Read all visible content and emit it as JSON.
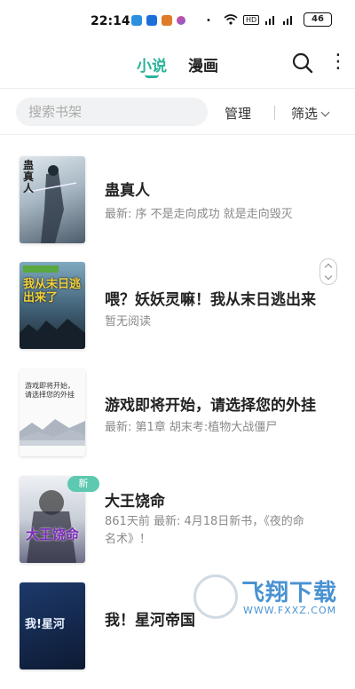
{
  "status_bar": {
    "time": "22:14",
    "signal_badge": "HD",
    "battery": "46",
    "bullet": "•"
  },
  "nav": {
    "tab_novel": "小说",
    "tab_comic": "漫画",
    "search_icon": "search-icon",
    "more_icon": "more-vertical-icon",
    "more_glyph": "⋮"
  },
  "toolbar": {
    "search_placeholder": "搜索书架",
    "manage_label": "管理",
    "filter_label": "筛选"
  },
  "books": [
    {
      "title": "蛊真人",
      "line1": "最新: 序 不是走向成功 就是走向毁灭",
      "line2": ""
    },
    {
      "title": "喂？妖妖灵嘛！我从末日逃出来",
      "line1": "暂无阅读",
      "line2": ""
    },
    {
      "title": "游戏即将开始，请选择您的外挂",
      "line1": "最新: 第1章 胡末考:植物大战僵尸",
      "line2": ""
    },
    {
      "title": "大王饶命",
      "line1": "861天前 最新: 4月18日新书，《夜的命",
      "line2": "名术》！",
      "badge": "新"
    },
    {
      "title": "我！星河帝国",
      "line1": "",
      "line2": ""
    }
  ],
  "covers": {
    "c1_text": "蛊真人",
    "c2_text": "我从末日逃出来了",
    "c3_text": "游戏即将开始，请选择您的外挂",
    "c4_text": "大王饶命",
    "c5_text": "我!星河"
  },
  "watermark": {
    "brand": "飞翔下载",
    "url": "WWW.FXXZ.COM"
  },
  "colors": {
    "accent": "#2ab39a",
    "badge": "#5cc9b0"
  }
}
